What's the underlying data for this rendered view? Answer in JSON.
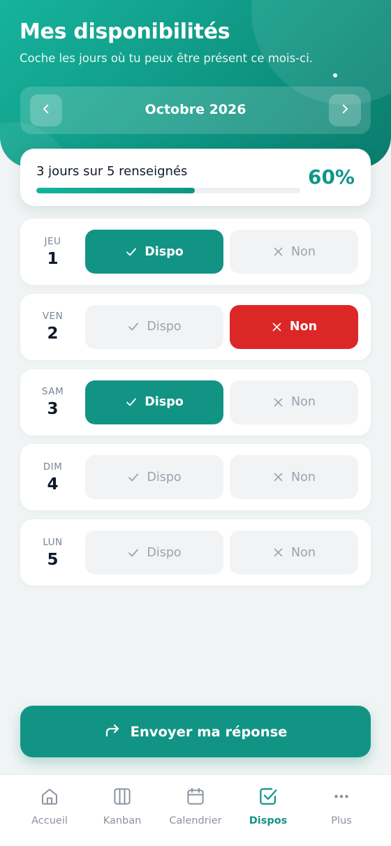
{
  "header": {
    "title": "Mes disponibilités",
    "subtitle": "Coche les jours où tu peux être présent ce mois-ci.",
    "month": "Octobre 2026",
    "prev_icon": "chevron-left-icon",
    "next_icon": "chevron-right-icon"
  },
  "progress": {
    "summary": "3 jours sur 5 renseignés",
    "percent_label": "60%",
    "fraction": 0.6
  },
  "option_labels": {
    "dispo": "Dispo",
    "non": "Non"
  },
  "days": [
    {
      "name": "JEU",
      "num": "1",
      "status": "dispo"
    },
    {
      "name": "VEN",
      "num": "2",
      "status": "non"
    },
    {
      "name": "SAM",
      "num": "3",
      "status": "dispo"
    },
    {
      "name": "DIM",
      "num": "4",
      "status": "none"
    },
    {
      "name": "LUN",
      "num": "5",
      "status": "none"
    }
  ],
  "submit": {
    "label": "Envoyer ma réponse",
    "icon": "share-arrow-icon"
  },
  "bottom_nav": [
    {
      "label": "Accueil",
      "icon": "home-icon",
      "active": false
    },
    {
      "label": "Kanban",
      "icon": "kanban-icon",
      "active": false
    },
    {
      "label": "Calendrier",
      "icon": "calendar-icon",
      "active": false
    },
    {
      "label": "Dispos",
      "icon": "checkbox-icon",
      "active": true
    },
    {
      "label": "Plus",
      "icon": "more-icon",
      "active": false
    }
  ],
  "colors": {
    "accent": "#129485",
    "danger": "#dc2727",
    "inactive": "#f1f3f5"
  }
}
